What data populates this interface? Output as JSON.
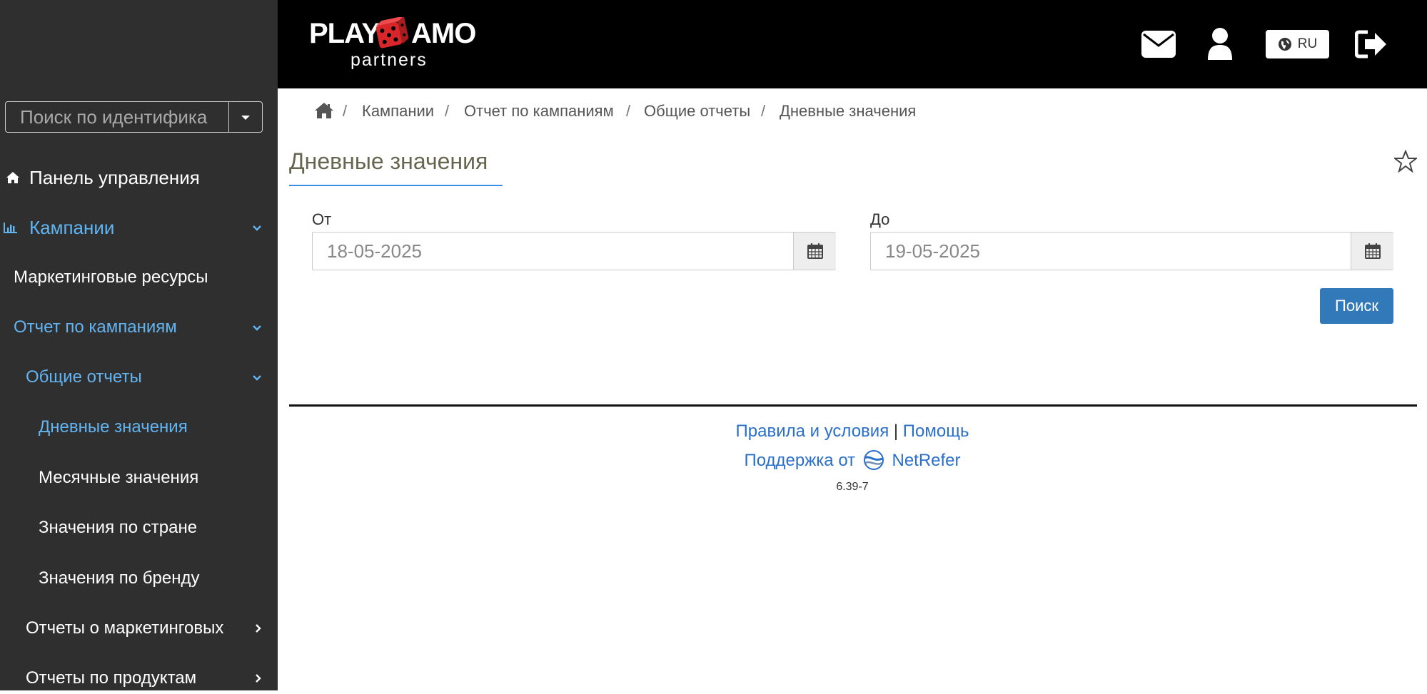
{
  "header": {
    "logo_main_left": "PLAY",
    "logo_main_right": "AMO",
    "logo_sub": "partners",
    "language": "RU"
  },
  "sidebar": {
    "search_placeholder": "Поиск по идентифика",
    "items": [
      {
        "label": "Панель управления",
        "icon": "home-icon"
      },
      {
        "label": "Кампании",
        "icon": "bar-chart-icon",
        "active": true,
        "expanded": true
      },
      {
        "label": "Маркетинговые ресурсы"
      },
      {
        "label": "Отчет по кампаниям",
        "active": true,
        "expanded": true
      },
      {
        "label": "Общие отчеты",
        "active": true,
        "expanded": true
      },
      {
        "label": "Дневные значения",
        "active": true
      },
      {
        "label": "Месячные значения"
      },
      {
        "label": "Значения по стране"
      },
      {
        "label": "Значения по бренду"
      },
      {
        "label": "Отчеты о маркетинговых",
        "collapsed": true
      },
      {
        "label": "Отчеты по продуктам",
        "collapsed": true
      }
    ]
  },
  "breadcrumb": [
    "Кампании",
    "Отчет по кампаниям",
    "Общие отчеты",
    "Дневные значения"
  ],
  "page": {
    "title": "Дневные значения",
    "from_label": "От",
    "from_value": "18-05-2025",
    "to_label": "До",
    "to_value": "19-05-2025",
    "search_button": "Поиск"
  },
  "footer": {
    "terms": "Правила и условия",
    "separator": "|",
    "help": "Помощь",
    "powered_by": "Поддержка от",
    "powered_brand": "NetRefer",
    "version": "6.39-7"
  },
  "colors": {
    "header_bg": "#000000",
    "sidebar_bg": "#2f2f2f",
    "active_link": "#62b4f0",
    "button_primary": "#3279b9",
    "title_underline": "#3a8ee6",
    "footer_link": "#2a6fc9",
    "dice_red": "#d9262a"
  }
}
